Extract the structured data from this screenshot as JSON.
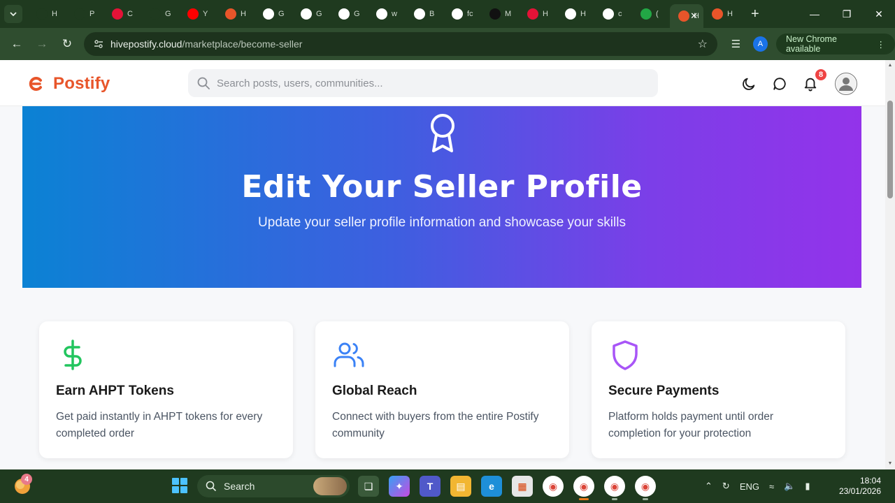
{
  "browser": {
    "tabs": [
      {
        "title": "H",
        "icon": "openai-icon",
        "color": "#1f3a1f"
      },
      {
        "title": "P",
        "icon": "openai-icon",
        "color": "#1f3a1f"
      },
      {
        "title": "C",
        "icon": "hive-icon",
        "color": "#e31337"
      },
      {
        "title": "G",
        "icon": "github-icon",
        "color": "#1f3a1f"
      },
      {
        "title": "Y",
        "icon": "youtube-icon",
        "color": "#ff0000"
      },
      {
        "title": "H",
        "icon": "postify-icon",
        "color": "#e8552a"
      },
      {
        "title": "G",
        "icon": "google-icon",
        "color": "#ffffff"
      },
      {
        "title": "G",
        "icon": "google-icon",
        "color": "#ffffff"
      },
      {
        "title": "G",
        "icon": "google-icon",
        "color": "#ffffff"
      },
      {
        "title": "w",
        "icon": "google-icon",
        "color": "#ffffff"
      },
      {
        "title": "B",
        "icon": "x-icon",
        "color": "#ffffff"
      },
      {
        "title": "fc",
        "icon": "google-icon",
        "color": "#ffffff"
      },
      {
        "title": "M",
        "icon": "globe-icon",
        "color": "#111111"
      },
      {
        "title": "H",
        "icon": "hive-icon",
        "color": "#e31337"
      },
      {
        "title": "H",
        "icon": "hive-blog-icon",
        "color": "#ffffff"
      },
      {
        "title": "c",
        "icon": "google-icon",
        "color": "#ffffff"
      },
      {
        "title": "(",
        "icon": "number-badge-icon",
        "color": "#22a745"
      },
      {
        "title": "H",
        "icon": "postify-icon",
        "color": "#e8552a",
        "active": true
      },
      {
        "title": "H",
        "icon": "postify-icon",
        "color": "#e8552a"
      }
    ],
    "url_host": "hivepostify.cloud",
    "url_path": "/marketplace/become-seller",
    "profile_initial": "A",
    "update_label": "New Chrome available"
  },
  "site": {
    "brand": "Postify",
    "brand_color": "#e8552a",
    "search_placeholder": "Search posts, users, communities...",
    "notification_count": "8"
  },
  "hero": {
    "title": "Edit Your Seller Profile",
    "subtitle": "Update your seller profile information and showcase your skills"
  },
  "features": [
    {
      "title": "Earn AHPT Tokens",
      "description": "Get paid instantly in AHPT tokens for every completed order",
      "icon": "dollar-icon",
      "color": "#22c55e"
    },
    {
      "title": "Global Reach",
      "description": "Connect with buyers from the entire Postify community",
      "icon": "users-icon",
      "color": "#3b82f6"
    },
    {
      "title": "Secure Payments",
      "description": "Platform holds payment until order completion for your protection",
      "icon": "shield-icon",
      "color": "#a855f7"
    }
  ],
  "taskbar": {
    "widget_badge": "4",
    "search_label": "Search",
    "language": "ENG",
    "time": "18:04",
    "date": "23/01/2026"
  }
}
